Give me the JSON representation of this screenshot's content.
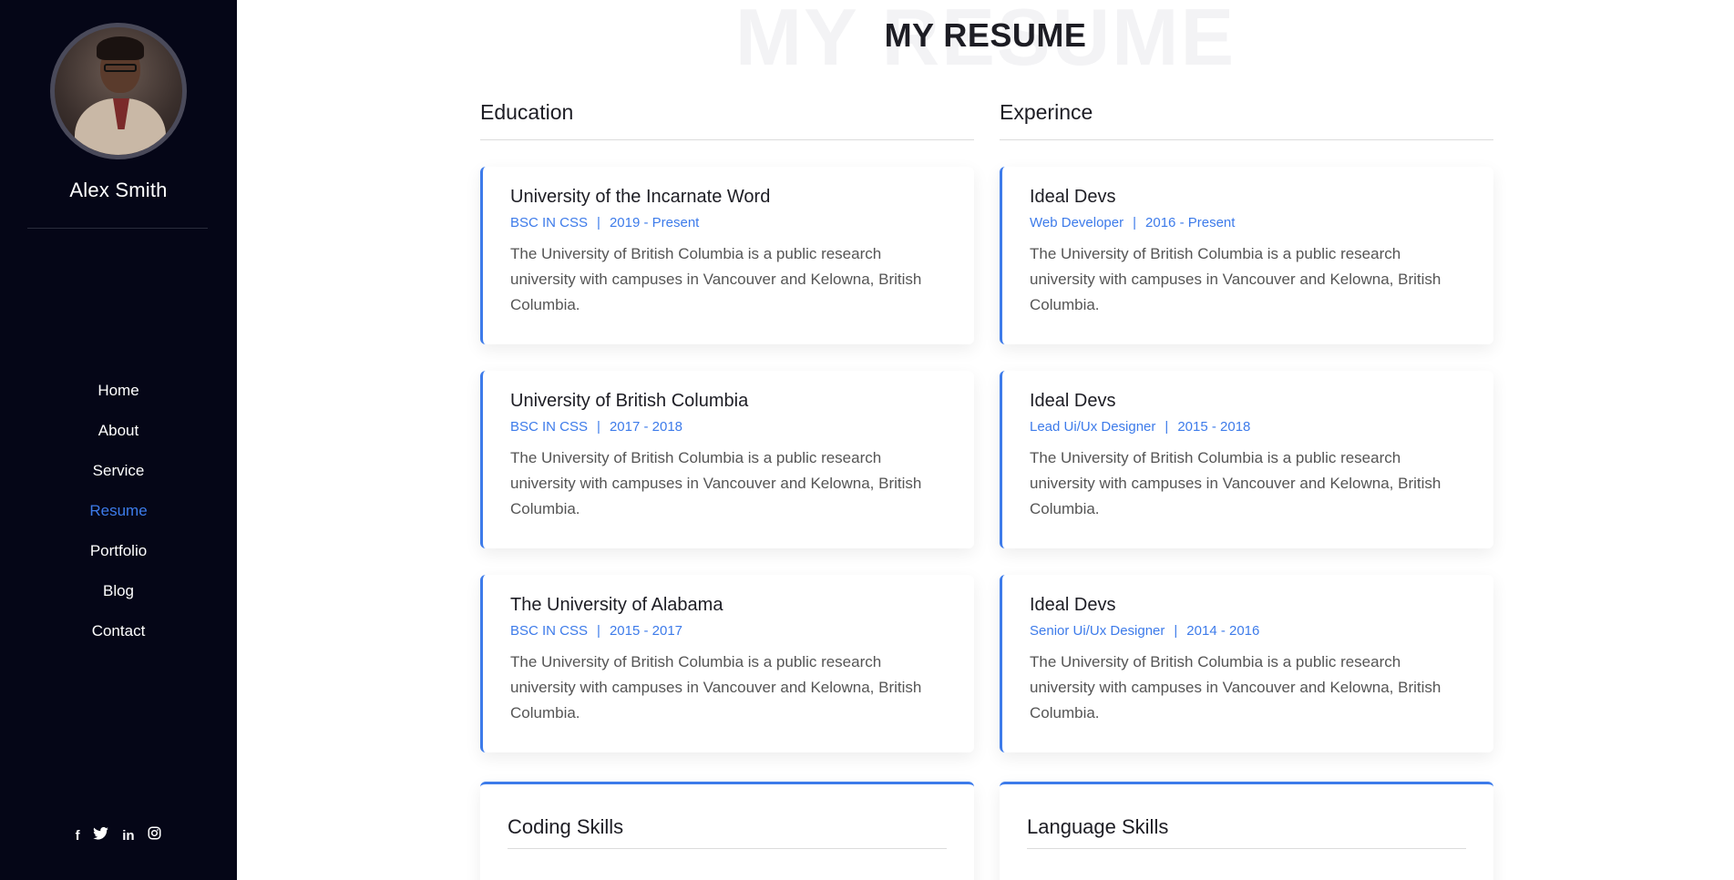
{
  "sidebar": {
    "name": "Alex Smith",
    "nav": [
      {
        "label": "Home",
        "active": false
      },
      {
        "label": "About",
        "active": false
      },
      {
        "label": "Service",
        "active": false
      },
      {
        "label": "Resume",
        "active": true
      },
      {
        "label": "Portfolio",
        "active": false
      },
      {
        "label": "Blog",
        "active": false
      },
      {
        "label": "Contact",
        "active": false
      }
    ],
    "socials": [
      "facebook-icon",
      "twitter-icon",
      "linkedin-icon",
      "instagram-icon"
    ]
  },
  "main": {
    "title_bg": "MY RESUME",
    "title": "MY RESUME",
    "education": {
      "heading": "Education",
      "items": [
        {
          "title": "University of the Incarnate Word",
          "degree": "BSC IN CSS",
          "years": "2019 - Present",
          "desc": "The University of British Columbia is a public research university with campuses in Vancouver and Kelowna, British Columbia."
        },
        {
          "title": "University of British Columbia",
          "degree": "BSC IN CSS",
          "years": "2017 - 2018",
          "desc": "The University of British Columbia is a public research university with campuses in Vancouver and Kelowna, British Columbia."
        },
        {
          "title": "The University of Alabama",
          "degree": "BSC IN CSS",
          "years": "2015 - 2017",
          "desc": "The University of British Columbia is a public research university with campuses in Vancouver and Kelowna, British Columbia."
        }
      ]
    },
    "experience": {
      "heading": "Experince",
      "items": [
        {
          "title": "Ideal Devs",
          "role": "Web Developer",
          "years": "2016 - Present",
          "desc": "The University of British Columbia is a public research university with campuses in Vancouver and Kelowna, British Columbia."
        },
        {
          "title": "Ideal Devs",
          "role": "Lead Ui/Ux Designer",
          "years": "2015 - 2018",
          "desc": "The University of British Columbia is a public research university with campuses in Vancouver and Kelowna, British Columbia."
        },
        {
          "title": "Ideal Devs",
          "role": "Senior Ui/Ux Designer",
          "years": "2014 - 2016",
          "desc": "The University of British Columbia is a public research university with campuses in Vancouver and Kelowna, British Columbia."
        }
      ]
    },
    "coding_skills": {
      "heading": "Coding Skills"
    },
    "language_skills": {
      "heading": "Language Skills"
    }
  },
  "colors": {
    "accent": "#3d7bea",
    "sidebar_bg": "#050617"
  }
}
